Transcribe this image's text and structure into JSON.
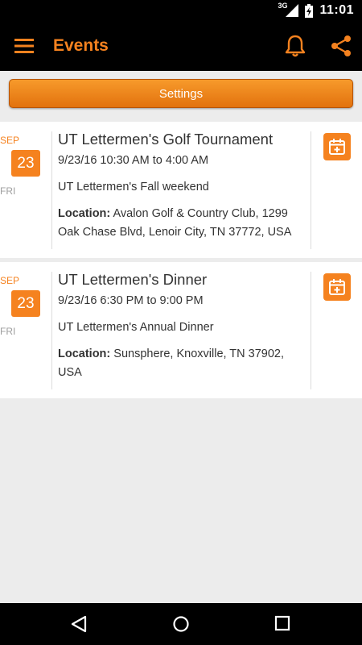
{
  "status_bar": {
    "network": "3G",
    "time": "11:01"
  },
  "app_bar": {
    "title": "Events"
  },
  "settings": {
    "label": "Settings"
  },
  "events": [
    {
      "month": "SEP",
      "day": "23",
      "weekday": "FRI",
      "title": "UT Lettermen's Golf Tournament",
      "time": "9/23/16 10:30 AM to 4:00 AM",
      "description": "UT Lettermen's Fall weekend",
      "location_label": "Location:",
      "location": "Avalon Golf & Country Club, 1299 Oak Chase Blvd, Lenoir City, TN 37772, USA"
    },
    {
      "month": "SEP",
      "day": "23",
      "weekday": "FRI",
      "title": "UT Lettermen's Dinner",
      "time": "9/23/16 6:30 PM to 9:00 PM",
      "description": "UT Lettermen's Annual Dinner",
      "location_label": "Location:",
      "location": "Sunsphere, Knoxville, TN 37902, USA"
    }
  ],
  "icons": {
    "menu": "menu-icon",
    "bell": "bell-icon",
    "share": "share-icon",
    "add_to_calendar": "calendar-add-icon",
    "back": "back-icon",
    "home": "home-icon",
    "recents": "recents-icon"
  },
  "colors": {
    "accent": "#f5821f",
    "bar": "#000000",
    "background": "#ececec"
  }
}
